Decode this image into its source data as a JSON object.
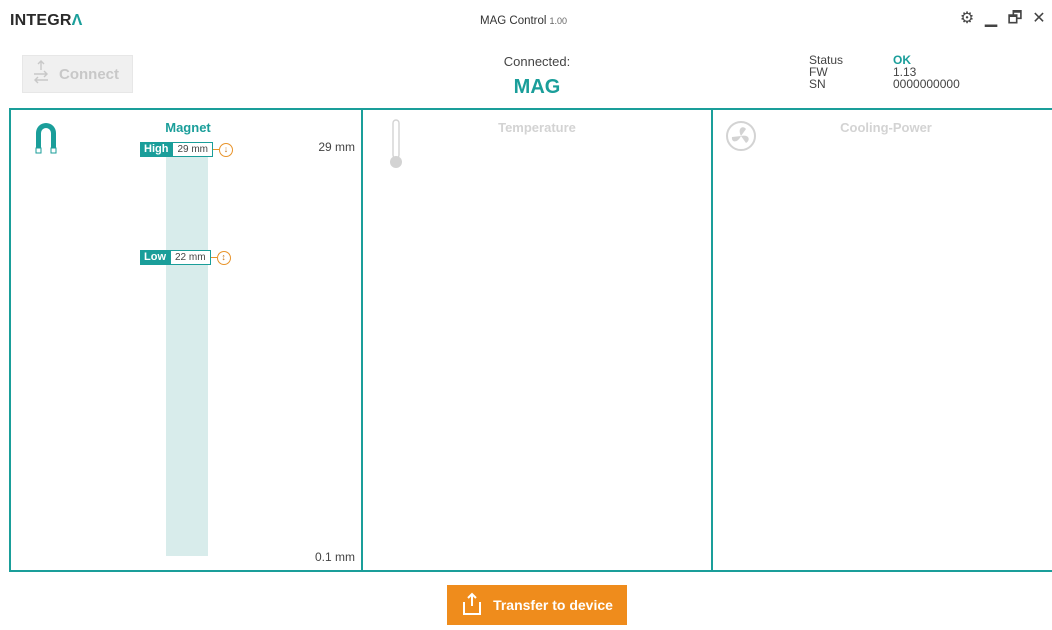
{
  "app": {
    "logo": "INTEGR",
    "logo_accent": "Λ",
    "title": "MAG Control",
    "version": "1.00"
  },
  "window_controls": [
    "gear-icon",
    "minimize-icon",
    "restore-icon",
    "close-icon"
  ],
  "header": {
    "connect_label": "Connect",
    "connected_label": "Connected:",
    "device_name": "MAG",
    "status": {
      "status_key": "Status",
      "status_val": "OK",
      "fw_key": "FW",
      "fw_val": "1.13",
      "sn_key": "SN",
      "sn_val": "0000000000"
    }
  },
  "panels": {
    "magnet": {
      "title": "Magnet",
      "scale_top": "29 mm",
      "scale_bottom": "0.1 mm",
      "high": {
        "label": "High",
        "value": "29 mm"
      },
      "low": {
        "label": "Low",
        "value": "22 mm"
      }
    },
    "temperature": {
      "title": "Temperature"
    },
    "cooling": {
      "title": "Cooling-Power"
    }
  },
  "footer": {
    "transfer_label": "Transfer to device"
  },
  "colors": {
    "accent": "#1a9e9a",
    "orange": "#ef8c1c",
    "disabled": "#d3d3d3"
  }
}
